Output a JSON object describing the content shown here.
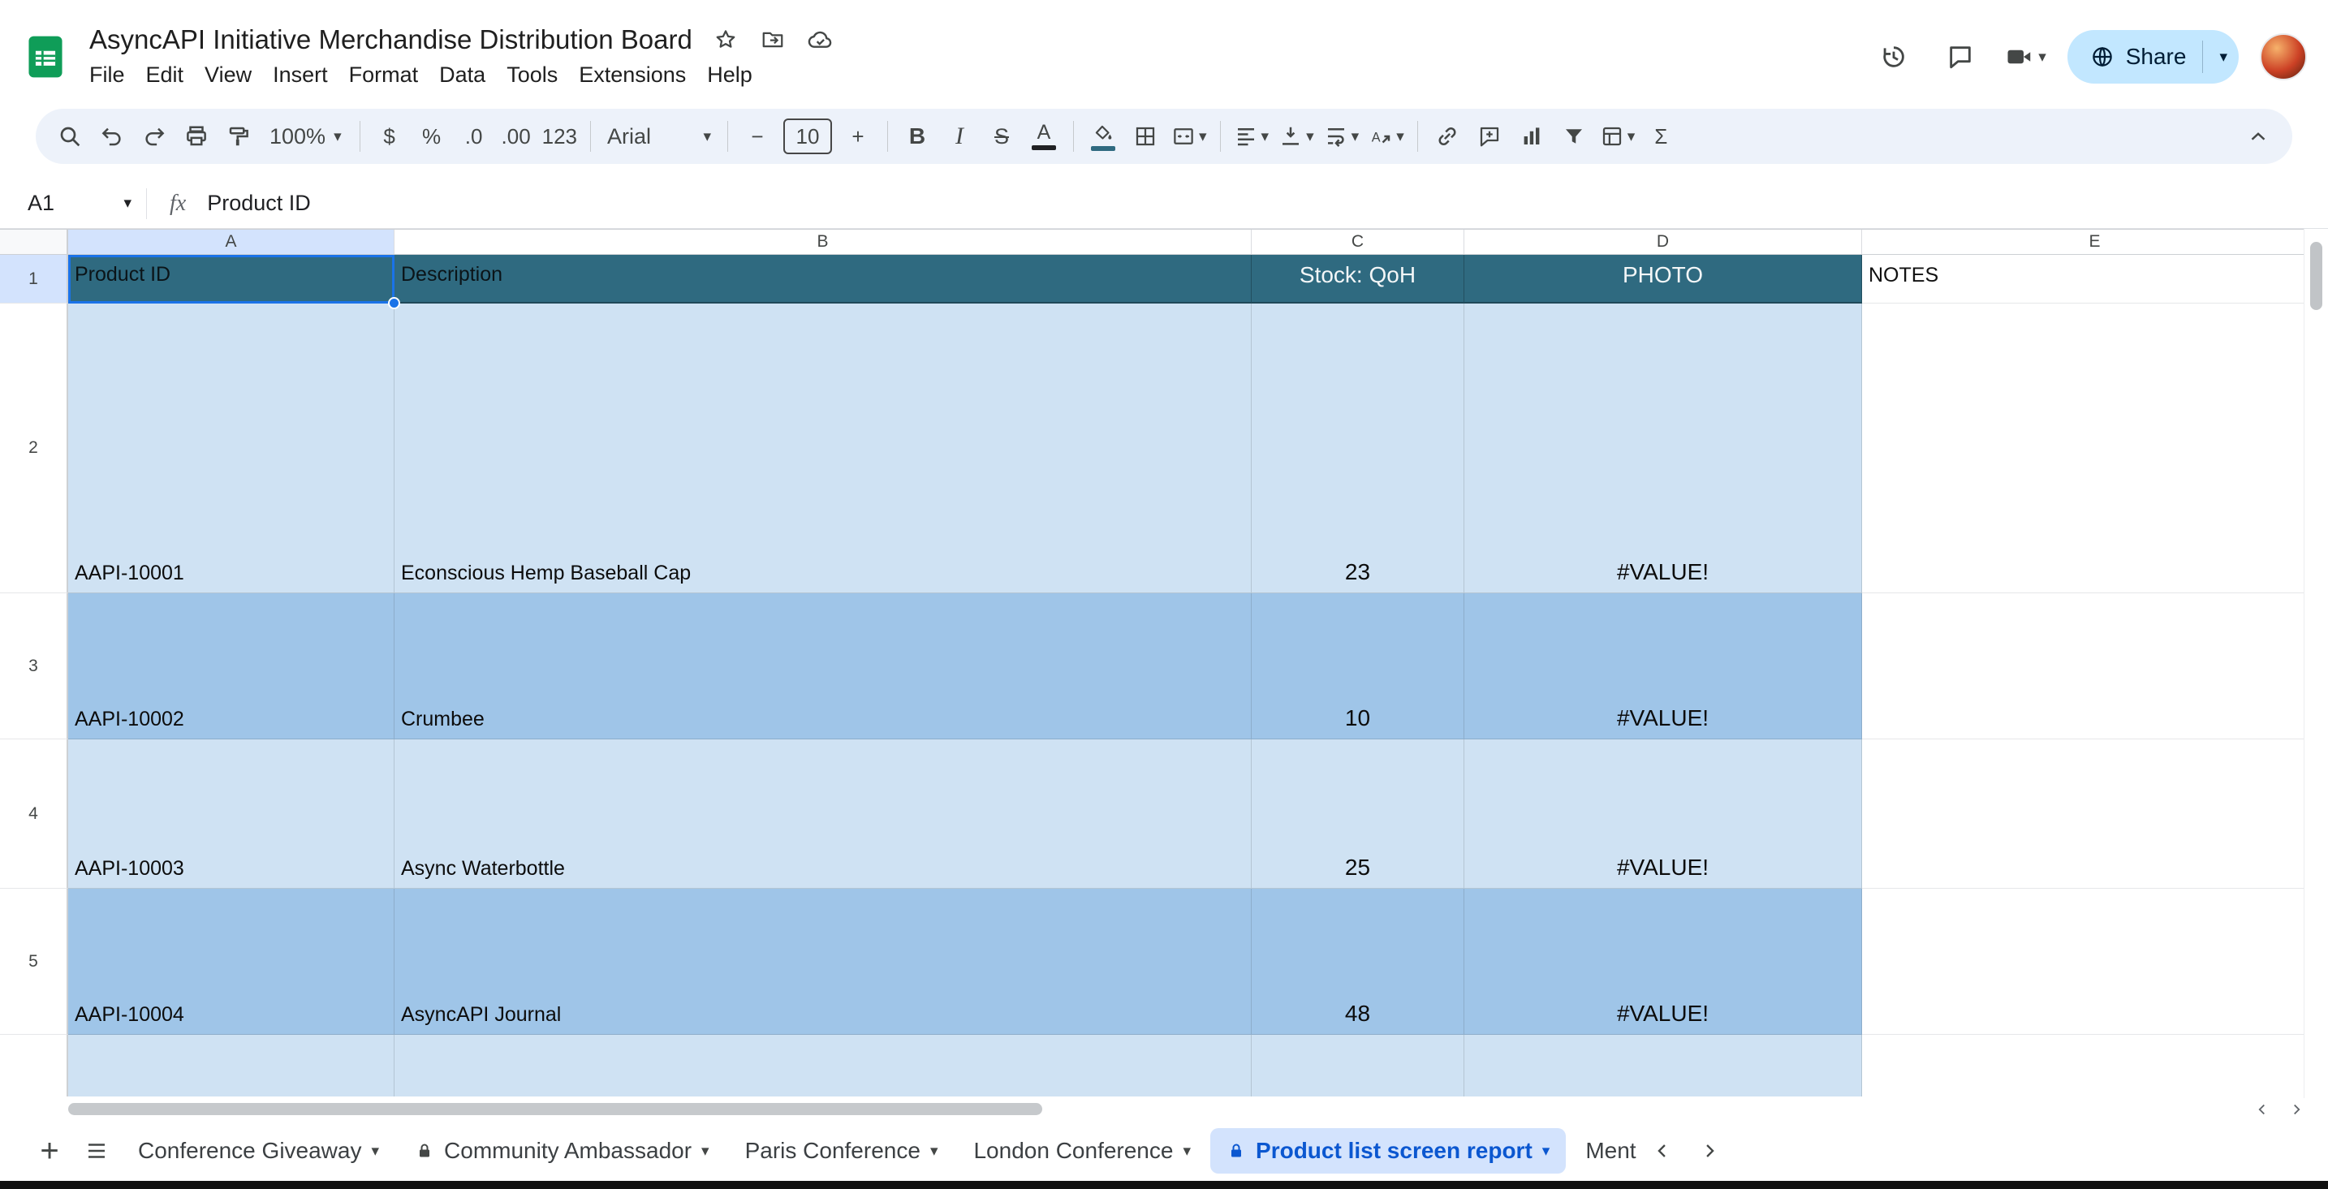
{
  "colors": {
    "header_fill": "#2f6a80",
    "band_light": "#cfe2f3",
    "band_dark": "#9fc5e8",
    "accent_blue": "#0b57d0",
    "selection_blue": "#1a73e8",
    "toolbar_bg": "#edf2fa",
    "share_pill": "#c2e7ff",
    "share_text": "#001d35",
    "active_tab_bg": "#d3e3fd",
    "logo_green": "#0f9d58"
  },
  "topbar": {
    "title": "AsyncAPI Initiative Merchandise Distribution Board",
    "menus": [
      "File",
      "Edit",
      "View",
      "Insert",
      "Format",
      "Data",
      "Tools",
      "Extensions",
      "Help"
    ],
    "share_label": "Share"
  },
  "toolbar": {
    "zoom_value": "100%",
    "currency": "$",
    "percent": "%",
    "decrease_decimal": ".0",
    "increase_decimal": ".00",
    "more_formats": "123",
    "font_name": "Arial",
    "decrease_font": "−",
    "font_size": "10",
    "increase_font": "+",
    "bold": "B",
    "italic": "I",
    "strikethrough": "S",
    "text_color": "A",
    "functions": "Σ"
  },
  "formula_bar": {
    "name_box": "A1",
    "fx": "fx",
    "content": "Product ID"
  },
  "grid": {
    "column_headers": [
      "A",
      "B",
      "C",
      "D",
      "E"
    ],
    "header_row": {
      "row_num": "1",
      "product_id": "Product ID",
      "description": "Description",
      "stock": "Stock: QoH",
      "photo": "PHOTO",
      "notes": "NOTES"
    },
    "rows": [
      {
        "row_num": "2",
        "product_id": "AAPI-10001",
        "description": "Econscious Hemp Baseball Cap",
        "stock": "23",
        "photo": "#VALUE!"
      },
      {
        "row_num": "3",
        "product_id": "AAPI-10002",
        "description": "Crumbee",
        "stock": "10",
        "photo": "#VALUE!"
      },
      {
        "row_num": "4",
        "product_id": "AAPI-10003",
        "description": "Async Waterbottle",
        "stock": "25",
        "photo": "#VALUE!"
      },
      {
        "row_num": "5",
        "product_id": "AAPI-10004",
        "description": "AsyncAPI Journal",
        "stock": "48",
        "photo": "#VALUE!"
      }
    ]
  },
  "sheet_tabs": [
    {
      "label": "Conference Giveaway"
    },
    {
      "label": "Community Ambassador"
    },
    {
      "label": "Paris Conference"
    },
    {
      "label": "London Conference"
    },
    {
      "label": "Product list screen report"
    },
    {
      "label": "Ment"
    }
  ]
}
